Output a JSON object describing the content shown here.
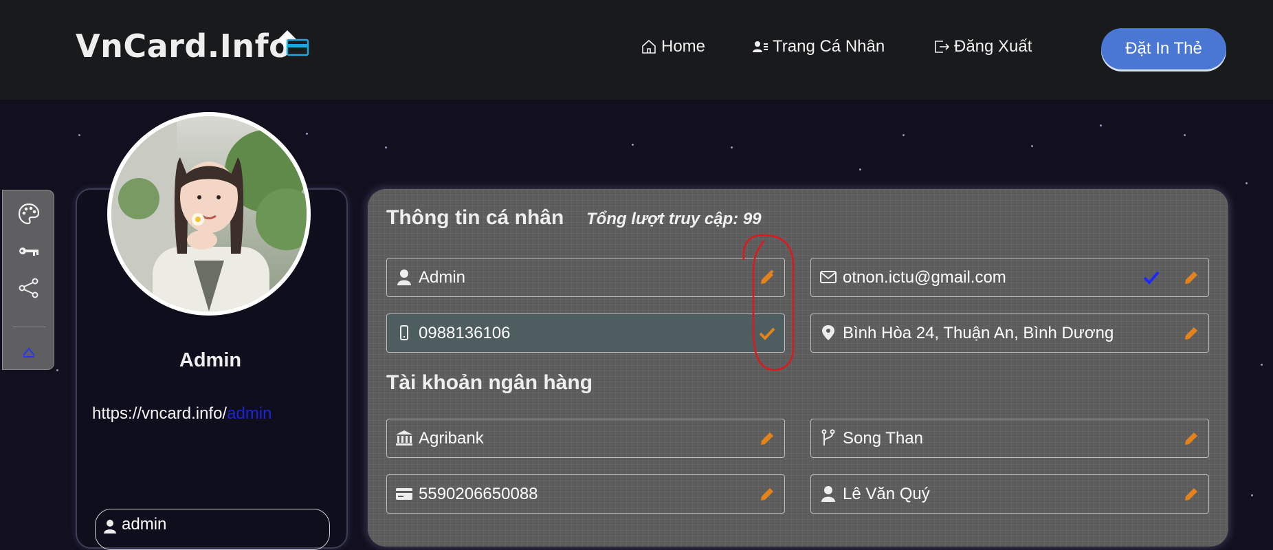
{
  "header": {
    "logo_text": "VnCard.Info",
    "nav": [
      {
        "label": "Home",
        "icon": "home-icon"
      },
      {
        "label": "Trang Cá Nhân",
        "icon": "profile-card-icon"
      },
      {
        "label": "Đăng Xuất",
        "icon": "logout-icon"
      }
    ],
    "order_button": "Đặt In Thẻ"
  },
  "toolbar": {
    "tools": [
      "palette-icon",
      "key-icon",
      "share-icon",
      "chevron-up-icon"
    ]
  },
  "profile": {
    "name": "Admin",
    "url_prefix": "https://vncard.info/",
    "url_slug": "admin",
    "username": "admin"
  },
  "personal_info": {
    "title": "Thông tin cá nhân",
    "visits_text": "Tổng lượt truy cập: 99",
    "fields": {
      "name": "Admin",
      "email": "otnon.ictu@gmail.com",
      "phone": "0988136106",
      "address": "Bình Hòa 24, Thuận An, Bình Dương"
    }
  },
  "bank_info": {
    "title": "Tài khoản ngân hàng",
    "fields": {
      "bank": "Agribank",
      "branch": "Song Than",
      "account_number": "5590206650088",
      "account_holder": "Lê Văn Quý"
    }
  },
  "colors": {
    "header_bg": "#191a1c",
    "page_bg": "#12101e",
    "accent_blue": "#4a77d4",
    "edit_orange": "#e2831c",
    "verified_blue": "#1b28ff",
    "annotation_red": "#e0181b"
  }
}
